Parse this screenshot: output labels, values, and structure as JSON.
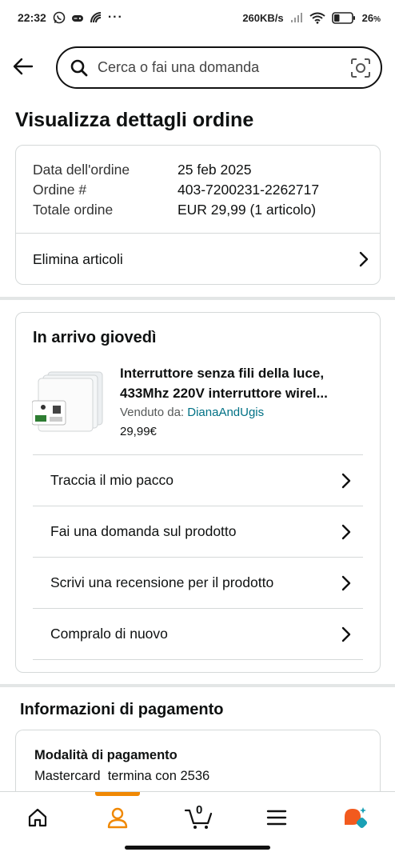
{
  "status_bar": {
    "time": "22:32",
    "dots": "···",
    "network_speed": "260KB/s",
    "battery": "26"
  },
  "search": {
    "placeholder": "Cerca o fai una domanda"
  },
  "page": {
    "title": "Visualizza dettagli ordine"
  },
  "order": {
    "date_label": "Data dell'ordine",
    "date_value": "25 feb 2025",
    "number_label": "Ordine #",
    "number_value": "403-7200231-2262717",
    "total_label": "Totale ordine",
    "total_value": "EUR 29,99 (1 articolo)",
    "delete_items": "Elimina articoli"
  },
  "delivery": {
    "title": "In arrivo giovedì",
    "product_name_line1": "Interruttore senza fili della luce,",
    "product_name_line2": "433Mhz 220V interruttore wirel...",
    "sold_by_label": "Venduto da:",
    "seller": "DianaAndUgis",
    "price": "29,99€",
    "actions": [
      {
        "label": "Traccia il mio pacco"
      },
      {
        "label": "Fai una domanda sul prodotto"
      },
      {
        "label": "Scrivi una recensione per il prodotto"
      },
      {
        "label": "Compralo di nuovo"
      }
    ]
  },
  "payment": {
    "title": "Informazioni di pagamento",
    "method_label": "Modalità di pagamento",
    "method_value": "Mastercard  termina con 2536"
  },
  "nav": {
    "cart_count": "0",
    "active_tab": "account",
    "accent_color": "#f08804"
  }
}
